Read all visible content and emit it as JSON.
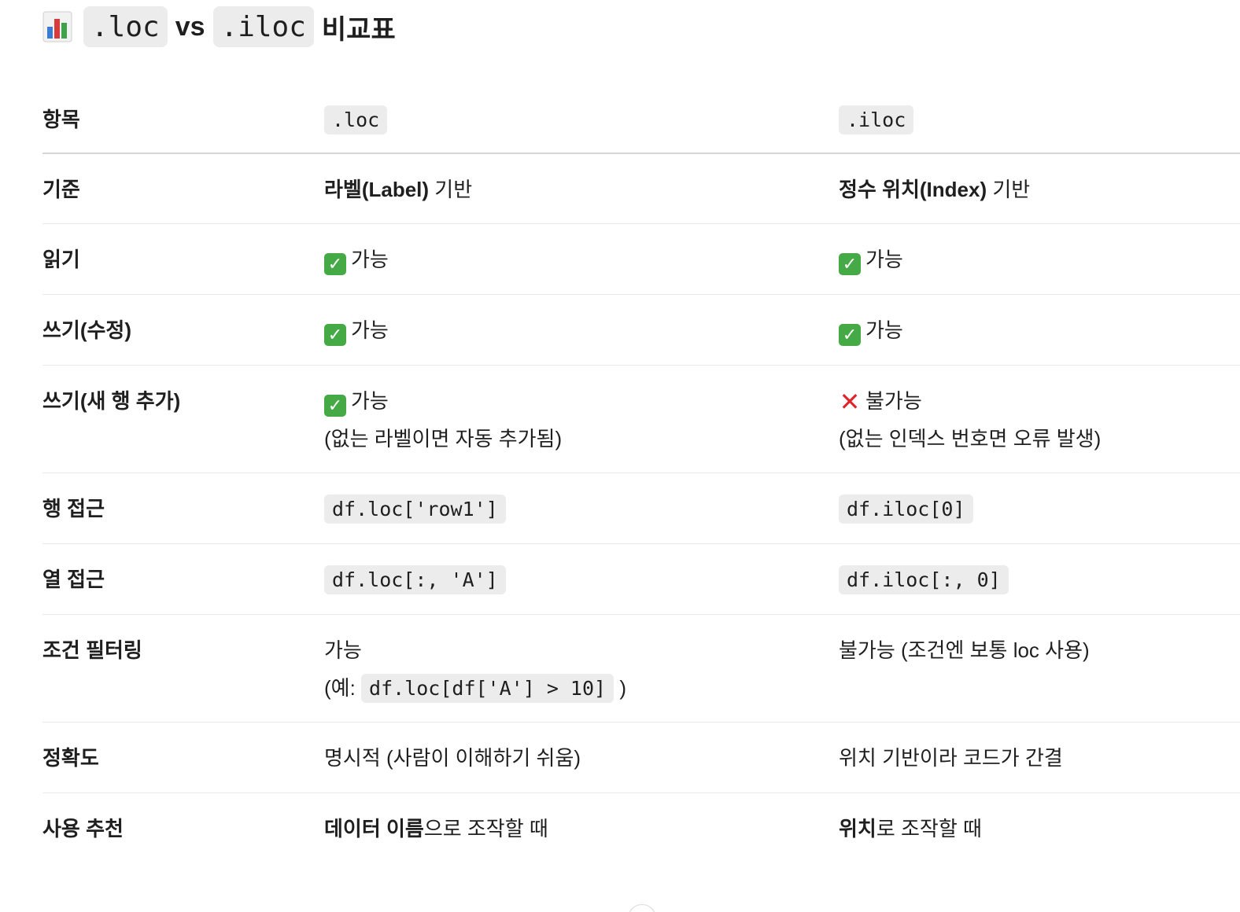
{
  "title": {
    "icon": "bar-chart-icon",
    "code1": ".loc",
    "vs": "vs",
    "code2": ".iloc",
    "suffix": "비교표"
  },
  "table": {
    "headers": [
      "항목",
      ".loc",
      ".iloc"
    ],
    "rows": [
      {
        "label": "기준",
        "loc": {
          "bold": "라벨(Label)",
          "rest": " 기반"
        },
        "iloc": {
          "bold": "정수 위치(Index)",
          "rest": " 기반"
        }
      },
      {
        "label": "읽기",
        "loc": {
          "icon": "check-icon",
          "text": "가능"
        },
        "iloc": {
          "icon": "check-icon",
          "text": "가능"
        }
      },
      {
        "label": "쓰기(수정)",
        "loc": {
          "icon": "check-icon",
          "text": "가능"
        },
        "iloc": {
          "icon": "check-icon",
          "text": "가능"
        }
      },
      {
        "label": "쓰기(새 행 추가)",
        "loc": {
          "icon": "check-icon",
          "text": "가능",
          "note": "(없는 라벨이면 자동 추가됨)"
        },
        "iloc": {
          "icon": "cross-icon",
          "text": "불가능",
          "note": "(없는 인덱스 번호면 오류 발생)"
        }
      },
      {
        "label": "행 접근",
        "loc": {
          "code": "df.loc['row1']"
        },
        "iloc": {
          "code": "df.iloc[0]"
        }
      },
      {
        "label": "열 접근",
        "loc": {
          "code": "df.loc[:, 'A']"
        },
        "iloc": {
          "code": "df.iloc[:, 0]"
        }
      },
      {
        "label": "조건 필터링",
        "loc": {
          "text": "가능",
          "note_prefix": "(예:",
          "note_code": "df.loc[df['A'] > 10]",
          "note_suffix": ")"
        },
        "iloc": {
          "text": "불가능 (조건엔 보통 loc 사용)"
        }
      },
      {
        "label": "정확도",
        "loc": {
          "text": "명시적 (사람이 이해하기 쉬움)"
        },
        "iloc": {
          "text": "위치 기반이라 코드가 간결"
        }
      },
      {
        "label": "사용 추천",
        "loc": {
          "bold": "데이터 이름",
          "rest": "으로 조작할 때"
        },
        "iloc": {
          "bold": "위치",
          "rest": "로 조작할 때"
        }
      }
    ]
  },
  "colors": {
    "check": "#45a945",
    "cross": "#e0242a",
    "code_bg": "#ececec"
  }
}
